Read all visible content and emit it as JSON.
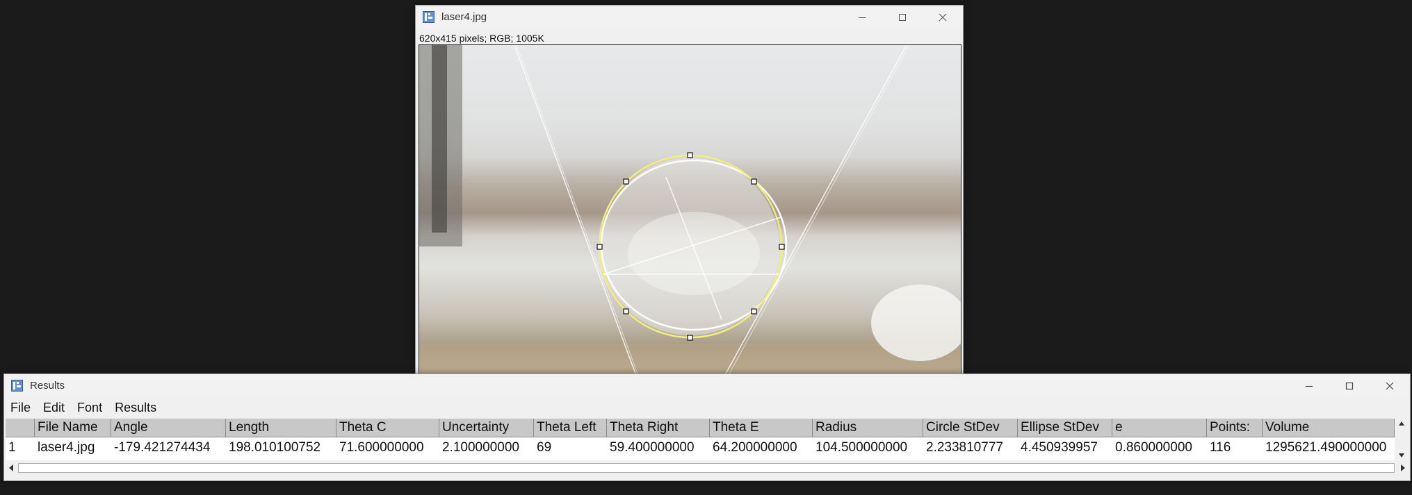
{
  "image_window": {
    "title": "laser4.jpg",
    "info": "620x415 pixels; RGB; 1005K",
    "icon": "imagej-icon"
  },
  "results_window": {
    "title": "Results",
    "icon": "imagej-icon",
    "menu": [
      "File",
      "Edit",
      "Font",
      "Results"
    ],
    "columns": [
      "",
      "File Name",
      "Angle",
      "Length",
      "Theta C",
      "Uncertainty",
      "Theta Left",
      "Theta Right",
      "Theta E",
      "Radius",
      "Circle StDev",
      "Ellipse StDev",
      "e",
      "Points:",
      "Volume"
    ],
    "rows": [
      [
        "1",
        "laser4.jpg",
        "-179.421274434",
        "198.010100752",
        "71.600000000",
        "2.100000000",
        "69",
        "59.400000000",
        "64.200000000",
        "104.500000000",
        "2.233810777",
        "4.450939957",
        "0.860000000",
        "116",
        "1295621.490000000"
      ]
    ]
  },
  "colors": {
    "desktop": "#1b1b1b",
    "titlebar": "#f2f2f2",
    "table_header": "#c8c8c8",
    "selection_yellow": "#f2ee7a"
  }
}
